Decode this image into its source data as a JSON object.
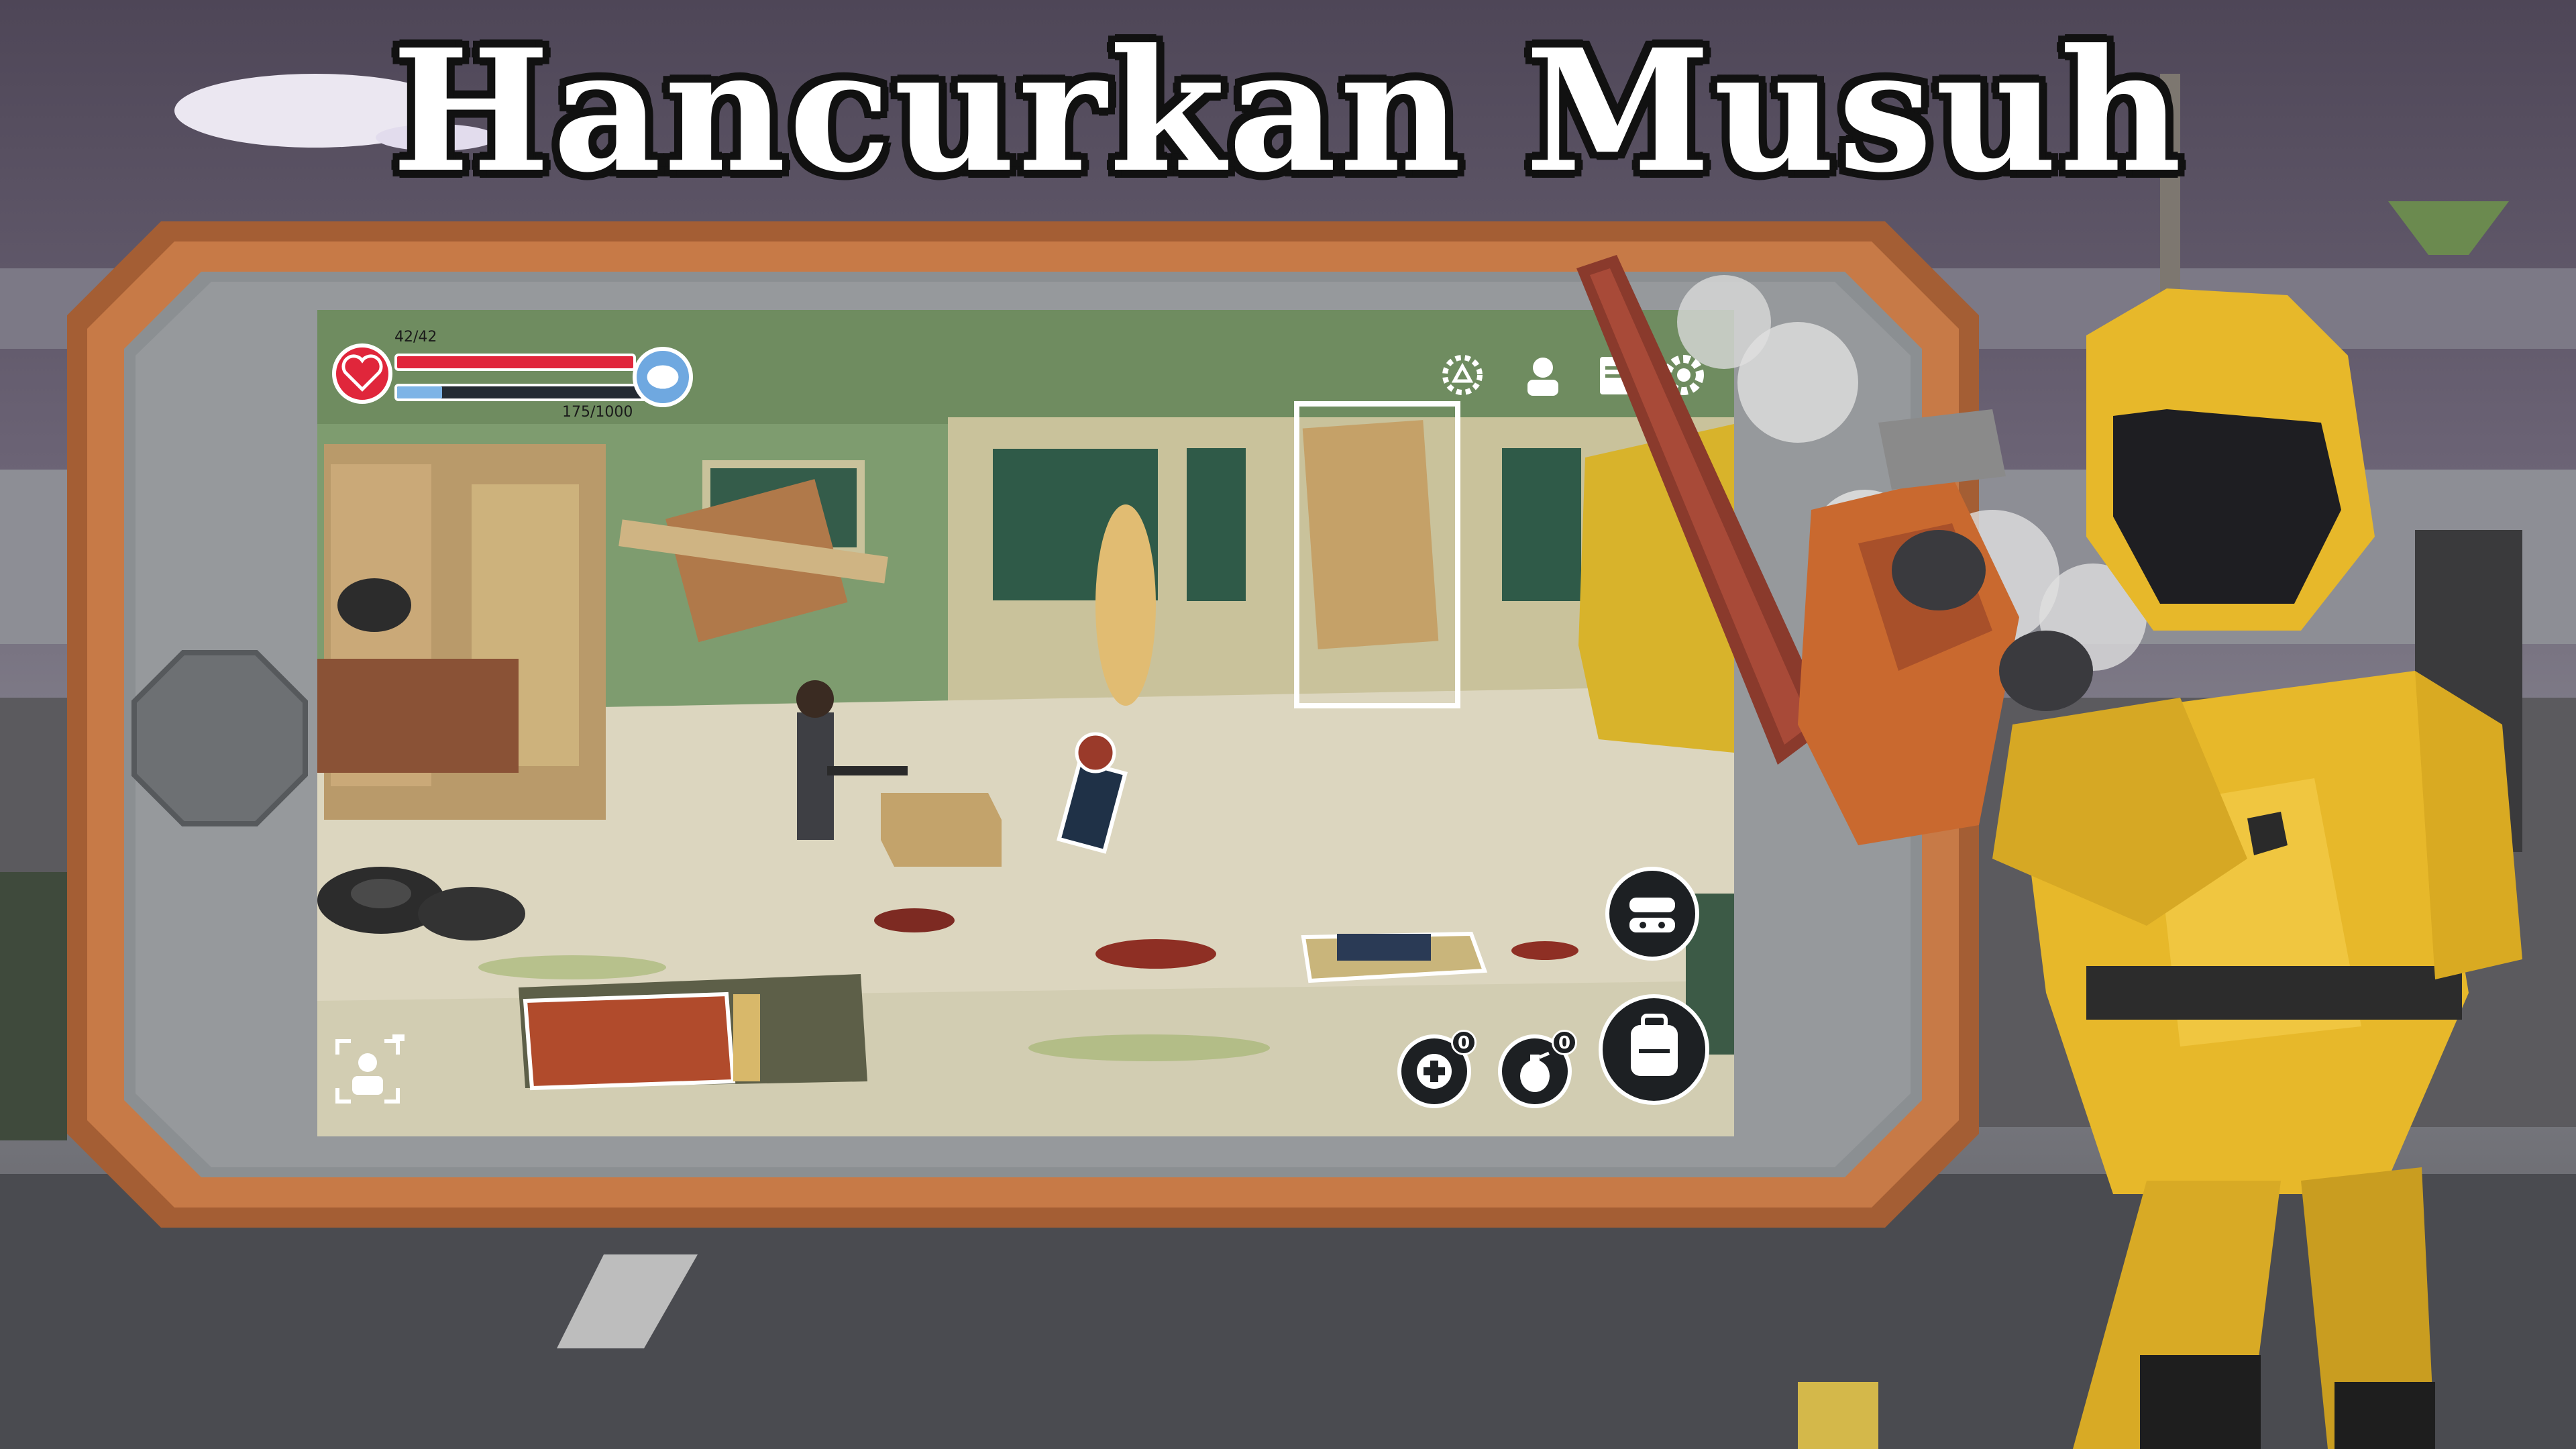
{
  "title": "Hancurkan Musuh",
  "hud": {
    "health_text": "42/42",
    "health_value": 42,
    "health_max": 42,
    "experience_text": "175/1000",
    "experience_value": 175,
    "experience_max": 1000,
    "heal_item_count": "0",
    "grenade_count": "0"
  },
  "colors": {
    "health_bar": "#e0263b",
    "experience_bar": "#7db4e6",
    "frame": "#b36a3c",
    "hazmat_suit": "#e7b82a"
  },
  "icons": {
    "health": "heart-icon",
    "experience": "brain-icon",
    "gear_badge": "gear-badge-icon",
    "profile": "profile-icon",
    "notes": "notes-icon",
    "settings": "settings-icon",
    "stealth": "stealth-mask-icon",
    "backpack": "backpack-icon",
    "heal": "medkit-plus-icon",
    "grenade": "grenade-icon",
    "camera": "camera-icon"
  }
}
